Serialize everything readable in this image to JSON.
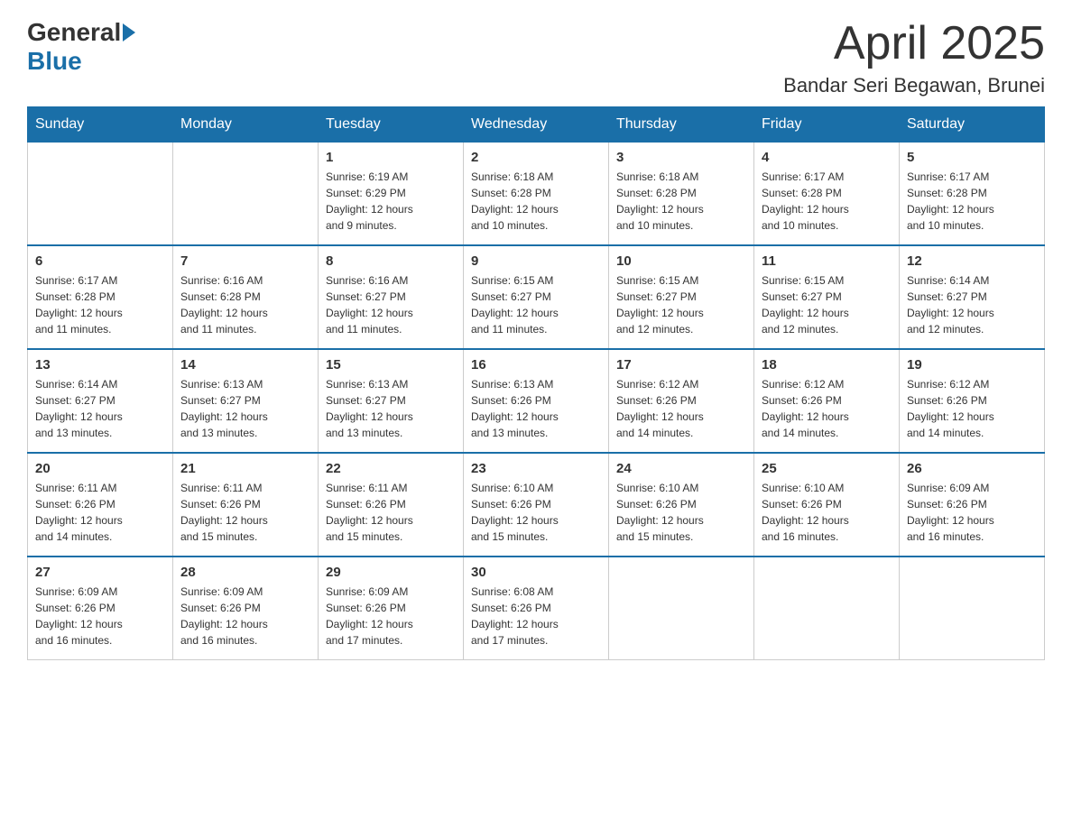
{
  "logo": {
    "general": "General",
    "blue": "Blue"
  },
  "title": "April 2025",
  "location": "Bandar Seri Begawan, Brunei",
  "days_of_week": [
    "Sunday",
    "Monday",
    "Tuesday",
    "Wednesday",
    "Thursday",
    "Friday",
    "Saturday"
  ],
  "weeks": [
    [
      {
        "day": "",
        "info": ""
      },
      {
        "day": "",
        "info": ""
      },
      {
        "day": "1",
        "info": "Sunrise: 6:19 AM\nSunset: 6:29 PM\nDaylight: 12 hours\nand 9 minutes."
      },
      {
        "day": "2",
        "info": "Sunrise: 6:18 AM\nSunset: 6:28 PM\nDaylight: 12 hours\nand 10 minutes."
      },
      {
        "day": "3",
        "info": "Sunrise: 6:18 AM\nSunset: 6:28 PM\nDaylight: 12 hours\nand 10 minutes."
      },
      {
        "day": "4",
        "info": "Sunrise: 6:17 AM\nSunset: 6:28 PM\nDaylight: 12 hours\nand 10 minutes."
      },
      {
        "day": "5",
        "info": "Sunrise: 6:17 AM\nSunset: 6:28 PM\nDaylight: 12 hours\nand 10 minutes."
      }
    ],
    [
      {
        "day": "6",
        "info": "Sunrise: 6:17 AM\nSunset: 6:28 PM\nDaylight: 12 hours\nand 11 minutes."
      },
      {
        "day": "7",
        "info": "Sunrise: 6:16 AM\nSunset: 6:28 PM\nDaylight: 12 hours\nand 11 minutes."
      },
      {
        "day": "8",
        "info": "Sunrise: 6:16 AM\nSunset: 6:27 PM\nDaylight: 12 hours\nand 11 minutes."
      },
      {
        "day": "9",
        "info": "Sunrise: 6:15 AM\nSunset: 6:27 PM\nDaylight: 12 hours\nand 11 minutes."
      },
      {
        "day": "10",
        "info": "Sunrise: 6:15 AM\nSunset: 6:27 PM\nDaylight: 12 hours\nand 12 minutes."
      },
      {
        "day": "11",
        "info": "Sunrise: 6:15 AM\nSunset: 6:27 PM\nDaylight: 12 hours\nand 12 minutes."
      },
      {
        "day": "12",
        "info": "Sunrise: 6:14 AM\nSunset: 6:27 PM\nDaylight: 12 hours\nand 12 minutes."
      }
    ],
    [
      {
        "day": "13",
        "info": "Sunrise: 6:14 AM\nSunset: 6:27 PM\nDaylight: 12 hours\nand 13 minutes."
      },
      {
        "day": "14",
        "info": "Sunrise: 6:13 AM\nSunset: 6:27 PM\nDaylight: 12 hours\nand 13 minutes."
      },
      {
        "day": "15",
        "info": "Sunrise: 6:13 AM\nSunset: 6:27 PM\nDaylight: 12 hours\nand 13 minutes."
      },
      {
        "day": "16",
        "info": "Sunrise: 6:13 AM\nSunset: 6:26 PM\nDaylight: 12 hours\nand 13 minutes."
      },
      {
        "day": "17",
        "info": "Sunrise: 6:12 AM\nSunset: 6:26 PM\nDaylight: 12 hours\nand 14 minutes."
      },
      {
        "day": "18",
        "info": "Sunrise: 6:12 AM\nSunset: 6:26 PM\nDaylight: 12 hours\nand 14 minutes."
      },
      {
        "day": "19",
        "info": "Sunrise: 6:12 AM\nSunset: 6:26 PM\nDaylight: 12 hours\nand 14 minutes."
      }
    ],
    [
      {
        "day": "20",
        "info": "Sunrise: 6:11 AM\nSunset: 6:26 PM\nDaylight: 12 hours\nand 14 minutes."
      },
      {
        "day": "21",
        "info": "Sunrise: 6:11 AM\nSunset: 6:26 PM\nDaylight: 12 hours\nand 15 minutes."
      },
      {
        "day": "22",
        "info": "Sunrise: 6:11 AM\nSunset: 6:26 PM\nDaylight: 12 hours\nand 15 minutes."
      },
      {
        "day": "23",
        "info": "Sunrise: 6:10 AM\nSunset: 6:26 PM\nDaylight: 12 hours\nand 15 minutes."
      },
      {
        "day": "24",
        "info": "Sunrise: 6:10 AM\nSunset: 6:26 PM\nDaylight: 12 hours\nand 15 minutes."
      },
      {
        "day": "25",
        "info": "Sunrise: 6:10 AM\nSunset: 6:26 PM\nDaylight: 12 hours\nand 16 minutes."
      },
      {
        "day": "26",
        "info": "Sunrise: 6:09 AM\nSunset: 6:26 PM\nDaylight: 12 hours\nand 16 minutes."
      }
    ],
    [
      {
        "day": "27",
        "info": "Sunrise: 6:09 AM\nSunset: 6:26 PM\nDaylight: 12 hours\nand 16 minutes."
      },
      {
        "day": "28",
        "info": "Sunrise: 6:09 AM\nSunset: 6:26 PM\nDaylight: 12 hours\nand 16 minutes."
      },
      {
        "day": "29",
        "info": "Sunrise: 6:09 AM\nSunset: 6:26 PM\nDaylight: 12 hours\nand 17 minutes."
      },
      {
        "day": "30",
        "info": "Sunrise: 6:08 AM\nSunset: 6:26 PM\nDaylight: 12 hours\nand 17 minutes."
      },
      {
        "day": "",
        "info": ""
      },
      {
        "day": "",
        "info": ""
      },
      {
        "day": "",
        "info": ""
      }
    ]
  ]
}
